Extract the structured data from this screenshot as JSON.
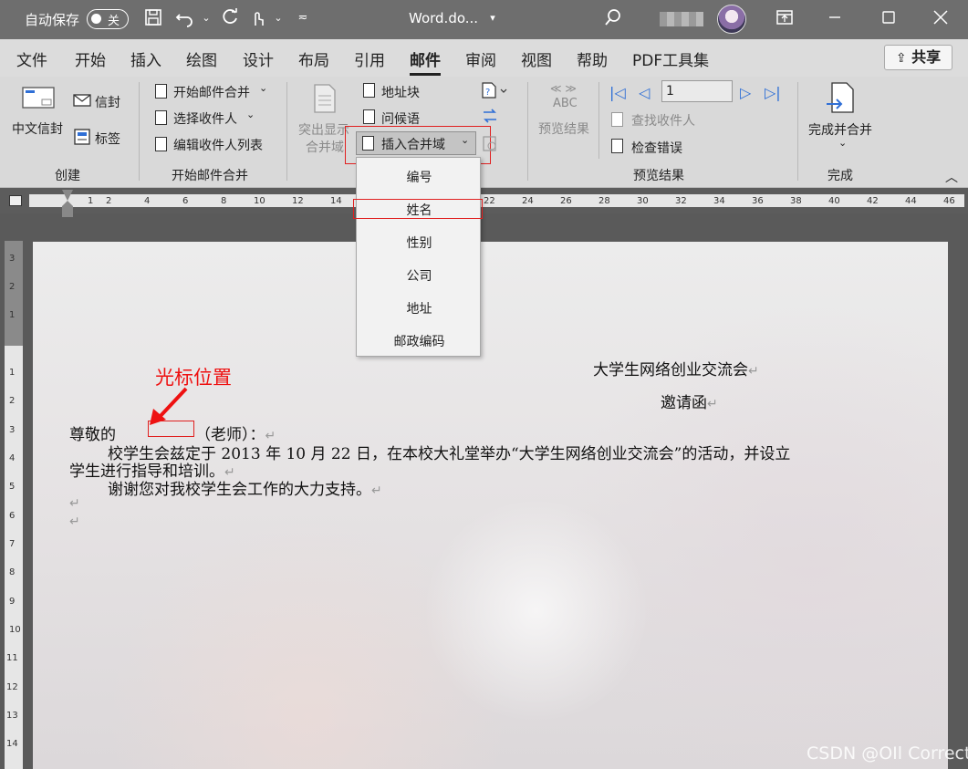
{
  "titlebar": {
    "autosave_label": "自动保存",
    "autosave_state": "关",
    "doc_title": "Word.do...",
    "buttons": [
      "save-icon",
      "undo-icon",
      "redo-icon",
      "touch-mode-icon",
      "customize-icon",
      "search-icon",
      "ribbon-display-icon",
      "minimize-icon",
      "maximize-icon",
      "close-icon"
    ]
  },
  "tabs": [
    "文件",
    "开始",
    "插入",
    "绘图",
    "设计",
    "布局",
    "引用",
    "邮件",
    "审阅",
    "视图",
    "帮助",
    "PDF工具集"
  ],
  "active_tab": "邮件",
  "share_label": "共享",
  "ribbon": {
    "create": {
      "group": "创建",
      "envelope_cn": "中文信封",
      "envelope": "信封",
      "label": "标签"
    },
    "start_merge": {
      "group": "开始邮件合并",
      "start": "开始邮件合并",
      "select": "选择收件人",
      "edit": "编辑收件人列表"
    },
    "write_insert": {
      "highlight_line1": "突出显示",
      "highlight_line2": "合并域",
      "address_block": "地址块",
      "greeting": "问候语",
      "insert_field": "插入合并域"
    },
    "preview": {
      "group": "预览结果",
      "preview_label": "预览结果",
      "abc": "ABC",
      "record": "1",
      "find": "查找收件人",
      "check": "检查错误"
    },
    "finish": {
      "group": "完成",
      "finish_label": "完成并合并"
    }
  },
  "ruler_ticks": [
    "1",
    "2",
    "4",
    "6",
    "8",
    "10",
    "12",
    "14",
    "22",
    "24",
    "26",
    "28",
    "30",
    "32",
    "34",
    "36",
    "38",
    "40",
    "42",
    "44",
    "46"
  ],
  "vruler_ticks": [
    "3",
    "2",
    "1",
    "1",
    "2",
    "3",
    "4",
    "5",
    "6",
    "7",
    "8",
    "9",
    "10",
    "11",
    "12",
    "13",
    "14"
  ],
  "dropdown": {
    "items": [
      "编号",
      "姓名",
      "性别",
      "公司",
      "地址",
      "邮政编码"
    ],
    "highlighted": "姓名"
  },
  "document": {
    "title1": "大学生网络创业交流会",
    "title2": "邀请函",
    "salutation_pre": "尊敬的",
    "salutation_post": "（老师）：",
    "para1_line1": "校学生会兹定于 2013 年 10 月 22 日，在本校大礼堂举办“大学生网络创业交流会”的活动，并设立",
    "para1_line2": "学生进行指导和培训。",
    "para2": "谢谢您对我校学生会工作的大力支持。",
    "para_mark": "↵"
  },
  "annotation": "光标位置",
  "watermark": "CSDN @OIl Correct"
}
